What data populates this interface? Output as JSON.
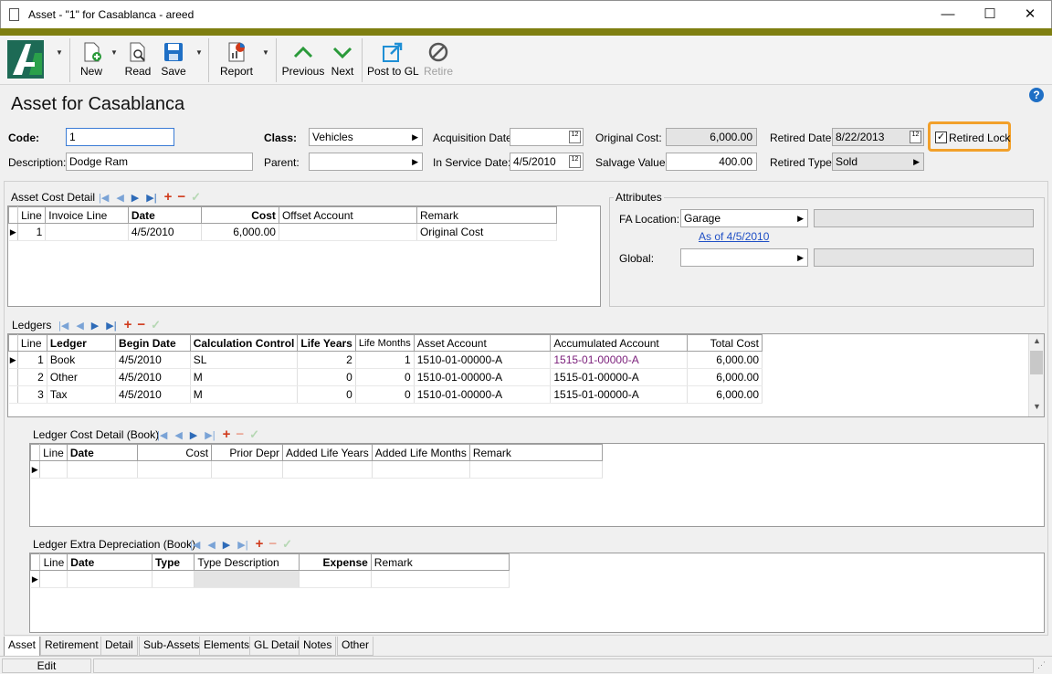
{
  "window": {
    "title": "Asset - \"1\" for Casablanca - areed",
    "min": "—",
    "max": "☐",
    "close": "✕"
  },
  "toolbar": {
    "new": "New",
    "read": "Read",
    "save": "Save",
    "report": "Report",
    "previous": "Previous",
    "next": "Next",
    "post": "Post to GL",
    "retire": "Retire"
  },
  "page": {
    "title": "Asset for Casablanca",
    "help": "?"
  },
  "form": {
    "code_label": "Code:",
    "code": "1",
    "description_label": "Description:",
    "description": "Dodge Ram",
    "class_label": "Class:",
    "class": "Vehicles",
    "parent_label": "Parent:",
    "parent": "",
    "acq_date_label": "Acquisition Date:",
    "acq_date": "",
    "in_service_label": "In Service Date:",
    "in_service": "4/5/2010",
    "orig_cost_label": "Original Cost:",
    "orig_cost": "6,000.00",
    "salvage_label": "Salvage Value:",
    "salvage": "400.00",
    "retired_date_label": "Retired Date:",
    "retired_date": "8/22/2013",
    "retired_type_label": "Retired Type:",
    "retired_type": "Sold",
    "retired_lock_label": "Retired Lock",
    "retired_lock_checked": true
  },
  "asset_cost": {
    "title": "Asset Cost Detail",
    "headers": [
      "Line",
      "Invoice Line",
      "Date",
      "Cost",
      "Offset Account",
      "Remark"
    ],
    "rows": [
      [
        "1",
        "",
        "4/5/2010",
        "6,000.00",
        "",
        "Original Cost"
      ]
    ]
  },
  "attributes": {
    "title": "Attributes",
    "fa_location_label": "FA Location:",
    "fa_location": "Garage",
    "as_of": "As of 4/5/2010",
    "global_label": "Global:",
    "global": ""
  },
  "ledgers": {
    "title": "Ledgers",
    "headers": [
      "Line",
      "Ledger",
      "Begin Date",
      "Calculation Control",
      "Life Years",
      "Life Months",
      "Asset Account",
      "Accumulated Account",
      "Total Cost"
    ],
    "rows": [
      [
        "1",
        "Book",
        "4/5/2010",
        "SL",
        "2",
        "1",
        "1510-01-00000-A",
        "1515-01-00000-A",
        "6,000.00"
      ],
      [
        "2",
        "Other",
        "4/5/2010",
        "M",
        "0",
        "0",
        "1510-01-00000-A",
        "1515-01-00000-A",
        "6,000.00"
      ],
      [
        "3",
        "Tax",
        "4/5/2010",
        "M",
        "0",
        "0",
        "1510-01-00000-A",
        "1515-01-00000-A",
        "6,000.00"
      ]
    ]
  },
  "ledger_cost": {
    "title": "Ledger Cost Detail (Book)",
    "headers": [
      "Line",
      "Date",
      "Cost",
      "Prior Depr",
      "Added Life Years",
      "Added Life Months",
      "Remark"
    ]
  },
  "ledger_extra": {
    "title": "Ledger Extra Depreciation (Book)",
    "headers": [
      "Line",
      "Date",
      "Type",
      "Type Description",
      "Expense",
      "Remark"
    ]
  },
  "tabs": [
    "Asset",
    "Retirement",
    "Detail",
    "Sub-Assets",
    "Elements",
    "GL Detail",
    "Notes",
    "Other"
  ],
  "status": {
    "mode": "Edit"
  }
}
